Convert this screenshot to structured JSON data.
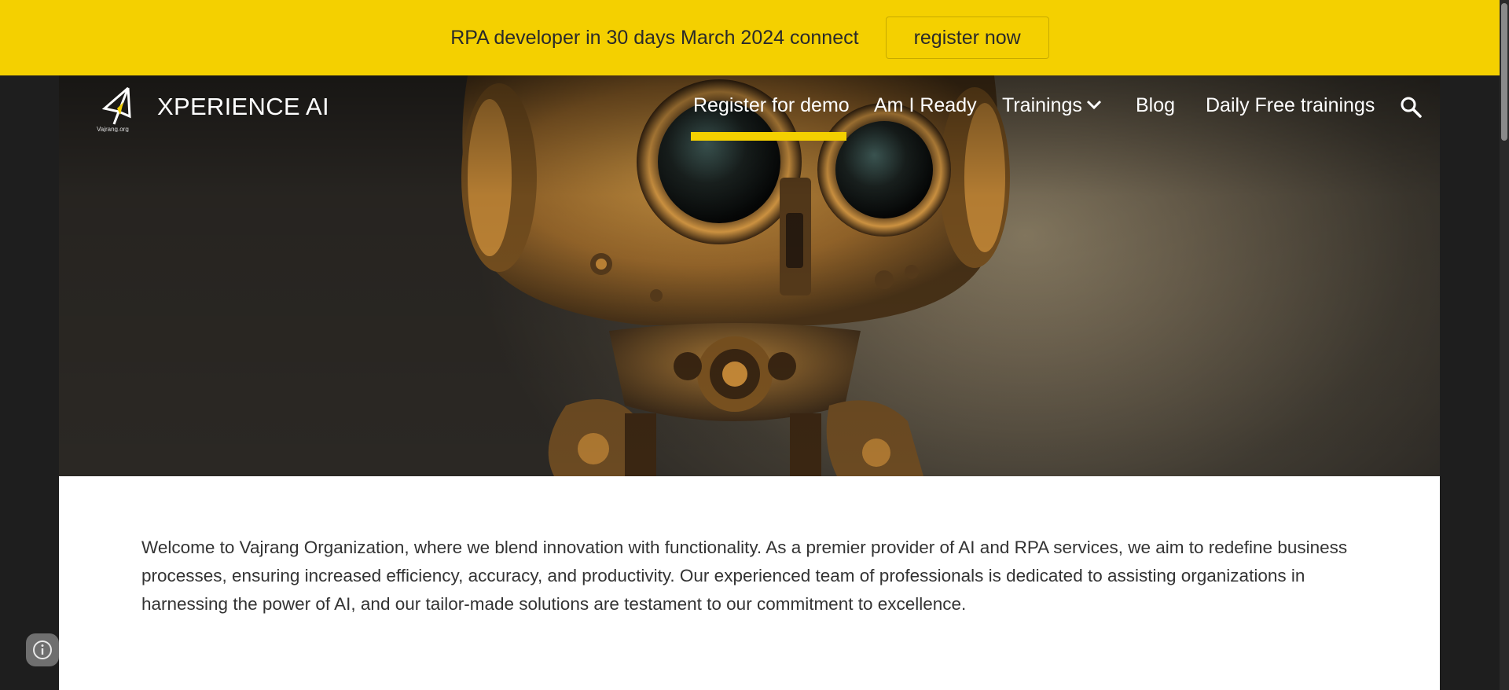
{
  "announcement": {
    "text": "RPA developer in 30 days March 2024 connect",
    "button_label": "register now",
    "background_color": "#f4d000"
  },
  "header": {
    "logo_icon": "vajrang-logo-icon",
    "logo_caption": "Vajrang.org",
    "site_title": "XPERIENCE AI",
    "nav": [
      {
        "label": "Register for demo",
        "active": true
      },
      {
        "label": "Am I Ready"
      },
      {
        "label": "Trainings",
        "has_dropdown": true,
        "dropdown_icon": "chevron-down-icon"
      },
      {
        "label": "Blog"
      },
      {
        "label": "Daily Free trainings"
      }
    ],
    "search_icon": "search-icon",
    "active_underline_color": "#f4d000"
  },
  "hero": {
    "image": "robot-illustration"
  },
  "main": {
    "intro": "Welcome to Vajrang Organization, where we blend innovation with functionality. As a premier provider of AI and RPA services, we aim to redefine business processes, ensuring increased efficiency, accuracy, and productivity. Our experienced team of professionals is dedicated to assisting organizations in harnessing the power of AI, and our tailor-made solutions are testament to our commitment to excellence."
  },
  "footer": {
    "info_icon": "info-icon"
  }
}
